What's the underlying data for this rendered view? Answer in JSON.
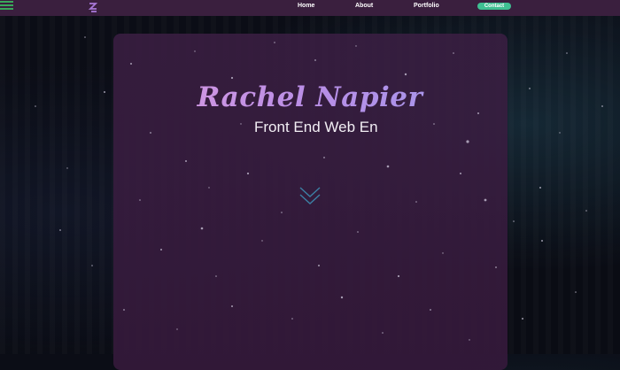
{
  "nav": {
    "menu_icon": "hamburger-icon",
    "logo_icon": "z-logo-icon",
    "links": [
      "Home",
      "About",
      "Portfolio"
    ],
    "contact_label": "Contact"
  },
  "hero": {
    "name": "Rachel Napier",
    "subtitle": "Front End Web En",
    "scroll_icon": "double-chevron-down-icon"
  },
  "colors": {
    "navbar": "#3a1f3e",
    "accent_green": "#3fbf92",
    "menu_green": "#39a85a",
    "name_gradient_start": "#f0a3dc",
    "name_gradient_end": "#8f9ef0",
    "arrow_blue": "#3c7fa3",
    "background": "#0b0d16"
  }
}
